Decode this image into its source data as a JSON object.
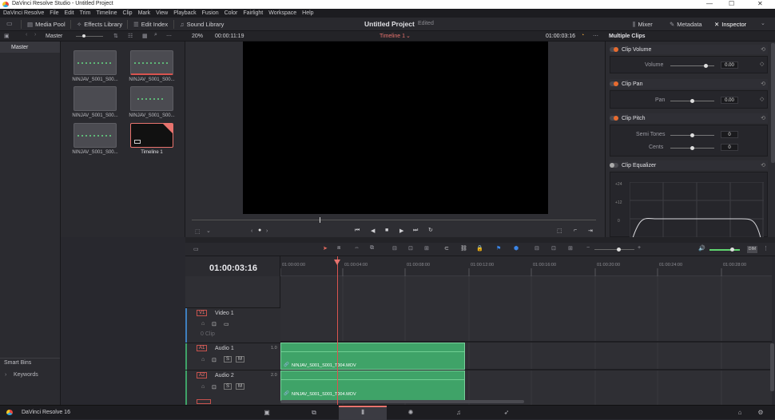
{
  "window": {
    "title": "DaVinci Resolve Studio - Untitled Project",
    "min": "—",
    "max": "☐",
    "close": "✕"
  },
  "menu": [
    "DaVinci Resolve",
    "File",
    "Edit",
    "Trim",
    "Timeline",
    "Clip",
    "Mark",
    "View",
    "Playback",
    "Fusion",
    "Color",
    "Fairlight",
    "Workspace",
    "Help"
  ],
  "toolbar": {
    "media_pool": "Media Pool",
    "effects_library": "Effects Library",
    "edit_index": "Edit Index",
    "sound_library": "Sound Library",
    "project_title": "Untitled Project",
    "project_status": "Edited",
    "mixer": "Mixer",
    "metadata": "Metadata",
    "inspector": "Inspector"
  },
  "subbar": {
    "bin": "Master",
    "zoom": "20%",
    "source_tc": "00:00:11:19",
    "timeline_name": "Timeline 1",
    "record_tc": "01:00:03:16",
    "inspector_title": "Multiple Clips"
  },
  "left": {
    "master": "Master",
    "smart_bins": "Smart Bins",
    "keywords": "Keywords"
  },
  "clips": [
    {
      "name": "NINJAV_S001_S00..."
    },
    {
      "name": "NINJAV_S001_S00..."
    },
    {
      "name": "NINJAV_S001_S00..."
    },
    {
      "name": "NINJAV_S001_S00..."
    },
    {
      "name": "NINJAV_S001_S00..."
    },
    {
      "name": "Timeline 1"
    }
  ],
  "inspector": {
    "clip_volume": {
      "title": "Clip Volume",
      "label": "Volume",
      "value": "0.00"
    },
    "clip_pan": {
      "title": "Clip Pan",
      "label": "Pan",
      "value": "0.00"
    },
    "clip_pitch": {
      "title": "Clip Pitch",
      "semitones_label": "Semi Tones",
      "semitones": "0",
      "cents_label": "Cents",
      "cents": "0"
    },
    "clip_eq": {
      "title": "Clip Equalizer",
      "ticks": [
        "+24",
        "+12",
        "0",
        "-12",
        "-24"
      ]
    }
  },
  "timeline": {
    "timecode": "01:00:03:16",
    "ruler": [
      "01:00:00:00",
      "01:00:04:00",
      "01:00:08:00",
      "01:00:12:00",
      "01:00:16:00",
      "01:00:20:00",
      "01:00:24:00",
      "01:00:28:00"
    ],
    "video1": {
      "badge": "V1",
      "name": "Video 1",
      "clips": "0 Clip"
    },
    "audio1": {
      "badge": "A1",
      "name": "Audio 1",
      "level": "1.0",
      "clip": "NINJAV_S001_S001_T004.MOV"
    },
    "audio2": {
      "badge": "A2",
      "name": "Audio 2",
      "level": "2.0",
      "clip": "NINJAV_S001_S001_T004.MOV"
    },
    "dim": "DIM"
  },
  "bottom": {
    "app": "DaVinci Resolve 16"
  }
}
